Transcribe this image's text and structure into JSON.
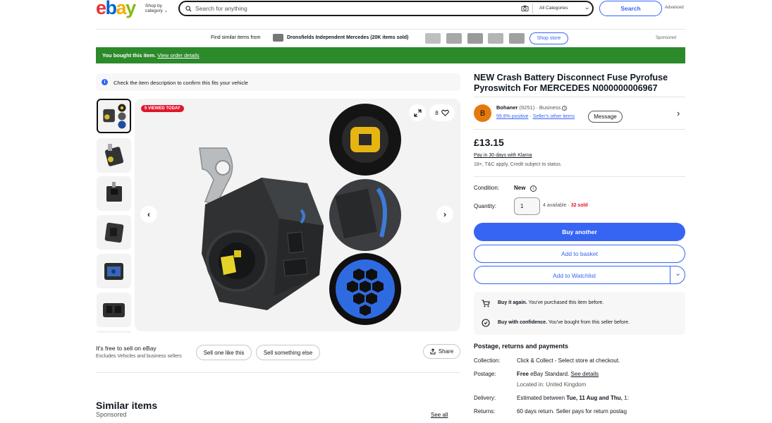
{
  "header": {
    "logo": "ebay",
    "shop_by": "Shop by",
    "category": "category",
    "search_placeholder": "Search for anything",
    "all_categories": "All Categories",
    "search_button": "Search",
    "advanced": "Advanced"
  },
  "sponsored_bar": {
    "find_similar": "Find similar items from",
    "seller_name": "Dronsfields Independent Mercedes",
    "sold_count": "(20K items sold)",
    "shop_store": "Shop store",
    "sponsored": "Sponsored"
  },
  "purchase_banner": {
    "text": "You bought this item.",
    "link": "View order details"
  },
  "info_notice": "Check the item description to confirm this fits your vehicle",
  "gallery": {
    "viewed_badge": "5 VIEWED TODAY",
    "watch_count": "8"
  },
  "sell": {
    "title": "It's free to sell on eBay",
    "subtitle": "Excludes Vehicles and business sellers",
    "sell_one": "Sell one like this",
    "sell_other": "Sell something else",
    "share": "Share"
  },
  "similar": {
    "title": "Similar items",
    "sponsored": "Sponsored",
    "see_all": "See all"
  },
  "product": {
    "title_line1": "NEW Crash Battery Disconnect Fuse Pyrofuse",
    "title_line2": "Pyroswitch For MERCEDES N000000006967",
    "seller_initial": "B",
    "seller_name": "Bohaner",
    "seller_score": "(9251)",
    "seller_type": "· Business",
    "positive": "99.8% positive",
    "other_items": "Seller's other items",
    "message": "Message",
    "price": "£13.15",
    "klarna": "Pay in 30 days with Klarna",
    "klarna_note": "18+, T&C apply, Credit subject to status.",
    "condition_label": "Condition:",
    "condition_value": "New",
    "quantity_label": "Quantity:",
    "quantity_value": "1",
    "available": "4 available ·",
    "sold": "32 sold",
    "buy_another": "Buy another",
    "add_basket": "Add to basket",
    "add_watchlist": "Add to Watchlist",
    "buy_again_bold": "Buy it again.",
    "buy_again_text": "You've purchased this item before.",
    "confidence_bold": "Buy with confidence.",
    "confidence_text": "You've bought from this seller before."
  },
  "postage": {
    "heading": "Postage, returns and payments",
    "collection_label": "Collection:",
    "collection_value": "Click & Collect - Select store at checkout.",
    "postage_label": "Postage:",
    "postage_free": "Free",
    "postage_value": "eBay Standard.",
    "see_details": "See details",
    "located": "Located in: United Kingdom",
    "delivery_label": "Delivery:",
    "delivery_prefix": "Estimated between",
    "delivery_dates": "Tue, 11 Aug and Thu, 1:",
    "returns_label": "Returns:",
    "returns_value": "60 days return. Seller pays for return postag"
  },
  "colors": {
    "ebay_red": "#e53238",
    "ebay_blue": "#0064d2",
    "ebay_yellow": "#f5af02",
    "ebay_green": "#86b817",
    "banner_green": "#2d8a2b",
    "primary_blue": "#3665f3",
    "badge_red": "#e0162b",
    "seller_orange": "#e5790c"
  }
}
